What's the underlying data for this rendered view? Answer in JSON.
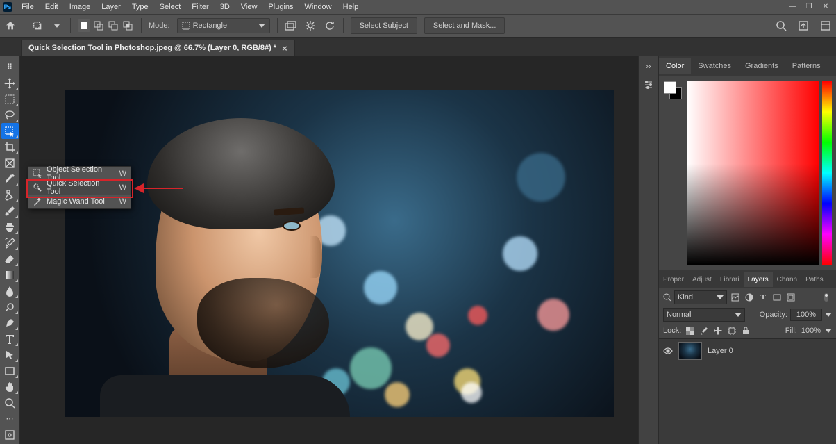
{
  "app_logo": "Ps",
  "menubar": {
    "items": [
      "File",
      "Edit",
      "Image",
      "Layer",
      "Type",
      "Select",
      "Filter",
      "3D",
      "View",
      "Plugins",
      "Window",
      "Help"
    ]
  },
  "optionsbar": {
    "mode_label": "Mode:",
    "mode_value": "Rectangle",
    "select_subject": "Select Subject",
    "select_and_mask": "Select and Mask..."
  },
  "doc_tab": {
    "title": "Quick Selection Tool in Photoshop.jpeg @ 66.7% (Layer 0, RGB/8#) *"
  },
  "tool_flyout": {
    "items": [
      {
        "label": "Object Selection Tool",
        "key": "W"
      },
      {
        "label": "Quick Selection Tool",
        "key": "W"
      },
      {
        "label": "Magic Wand Tool",
        "key": "W"
      }
    ],
    "selected_index": 1
  },
  "colorpanel": {
    "tabs": [
      "Color",
      "Swatches",
      "Gradients",
      "Patterns"
    ],
    "active": 0
  },
  "proppanel": {
    "tabs": [
      "Proper",
      "Adjust",
      "Librari",
      "Layers",
      "Chann",
      "Paths"
    ],
    "active": 3
  },
  "layers": {
    "filter_kind": "Kind",
    "blend_mode": "Normal",
    "opacity_label": "Opacity:",
    "opacity_value": "100%",
    "lock_label": "Lock:",
    "fill_label": "Fill:",
    "fill_value": "100%",
    "items": [
      {
        "name": "Layer 0",
        "visible": true
      }
    ]
  },
  "search_placeholder": "Search"
}
